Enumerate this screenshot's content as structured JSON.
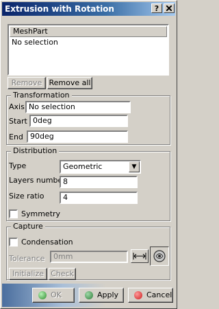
{
  "window": {
    "title": "Extrusion with Rotation",
    "help_button": "?",
    "close_button": "X"
  },
  "meshpart": {
    "column_header": "MeshPart",
    "selection": "No selection",
    "remove_label": "Remove",
    "remove_all_label": "Remove all"
  },
  "transformation": {
    "legend": "Transformation",
    "axis_label": "Axis",
    "axis_value": "No selection",
    "start_label": "Start",
    "start_value": "0deg",
    "end_label": "End",
    "end_value": "90deg"
  },
  "distribution": {
    "legend": "Distribution",
    "type_label": "Type",
    "type_value": "Geometric",
    "layers_label": "Layers number",
    "layers_value": "8",
    "ratio_label": "Size ratio",
    "ratio_value": "4",
    "symmetry_label": "Symmetry",
    "symmetry_checked": false
  },
  "capture": {
    "legend": "Capture",
    "condensation_label": "Condensation",
    "condensation_checked": false,
    "tolerance_label": "Tolerance",
    "tolerance_value": "0mm",
    "initialize_label": "Initialize",
    "check_label": "Check"
  },
  "footer": {
    "ok_label": "OK",
    "apply_label": "Apply",
    "cancel_label": "Cancel"
  },
  "colors": {
    "title_bar": "#0a246a",
    "ok_dot": "#2e8b2e",
    "apply_dot": "#2e7d3a",
    "cancel_dot": "#cc1f1f"
  }
}
